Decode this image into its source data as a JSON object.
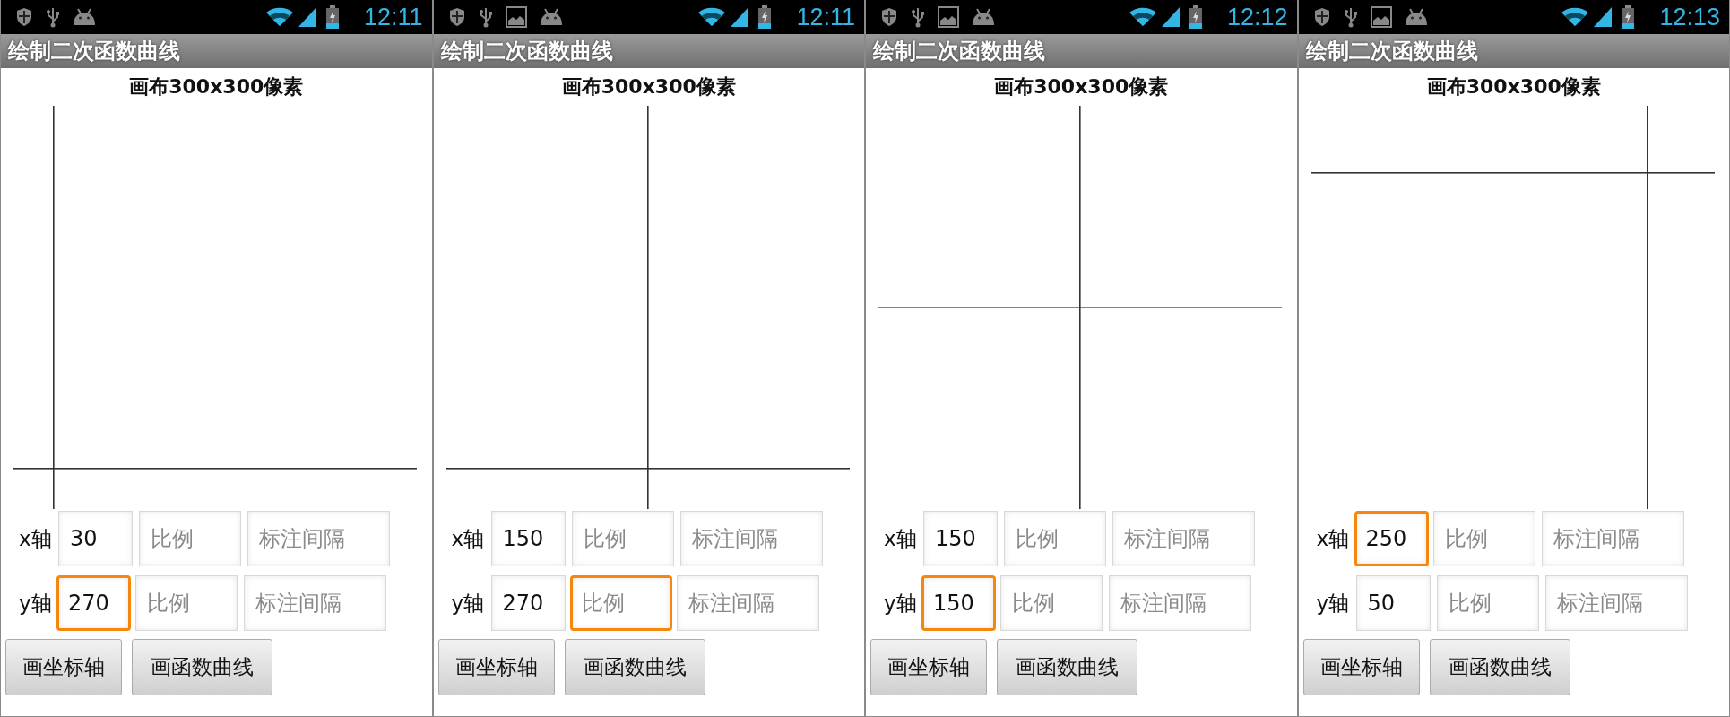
{
  "phones": [
    {
      "status_bar": {
        "notification_icons": [
          {
            "kind": "shield"
          },
          {
            "kind": "usb"
          },
          {
            "kind": "android"
          }
        ],
        "time": "12:11"
      },
      "title": "绘制二次函数曲线",
      "canvas_label": "画布300x300像素",
      "rows": [
        {
          "label": "x轴",
          "fields": [
            {
              "value": "30",
              "focused": false
            },
            {
              "placeholder": "比例",
              "focused": false
            },
            {
              "placeholder": "标注间隔",
              "focused": false
            }
          ]
        },
        {
          "label": "y轴",
          "fields": [
            {
              "value": "270",
              "focused": true
            },
            {
              "placeholder": "比例",
              "focused": false
            },
            {
              "placeholder": "标注间隔",
              "focused": false
            }
          ]
        }
      ],
      "buttons": [
        "画坐标轴",
        "画函数曲线"
      ]
    },
    {
      "status_bar": {
        "notification_icons": [
          {
            "kind": "shield"
          },
          {
            "kind": "usb"
          },
          {
            "kind": "picture"
          },
          {
            "kind": "android"
          }
        ],
        "time": "12:11"
      },
      "title": "绘制二次函数曲线",
      "canvas_label": "画布300x300像素",
      "rows": [
        {
          "label": "x轴",
          "fields": [
            {
              "value": "150",
              "focused": false
            },
            {
              "placeholder": "比例",
              "focused": false
            },
            {
              "placeholder": "标注间隔",
              "focused": false
            }
          ]
        },
        {
          "label": "y轴",
          "fields": [
            {
              "value": "270",
              "focused": false
            },
            {
              "placeholder": "比例",
              "focused": true
            },
            {
              "placeholder": "标注间隔",
              "focused": false
            }
          ]
        }
      ],
      "buttons": [
        "画坐标轴",
        "画函数曲线"
      ]
    },
    {
      "status_bar": {
        "notification_icons": [
          {
            "kind": "shield"
          },
          {
            "kind": "usb"
          },
          {
            "kind": "picture"
          },
          {
            "kind": "android"
          }
        ],
        "time": "12:12"
      },
      "title": "绘制二次函数曲线",
      "canvas_label": "画布300x300像素",
      "rows": [
        {
          "label": "x轴",
          "fields": [
            {
              "value": "150",
              "focused": false
            },
            {
              "placeholder": "比例",
              "focused": false
            },
            {
              "placeholder": "标注间隔",
              "focused": false
            }
          ]
        },
        {
          "label": "y轴",
          "fields": [
            {
              "value": "150",
              "focused": true
            },
            {
              "placeholder": "比例",
              "focused": false
            },
            {
              "placeholder": "标注间隔",
              "focused": false
            }
          ]
        }
      ],
      "buttons": [
        "画坐标轴",
        "画函数曲线"
      ]
    },
    {
      "status_bar": {
        "notification_icons": [
          {
            "kind": "shield"
          },
          {
            "kind": "usb"
          },
          {
            "kind": "picture"
          },
          {
            "kind": "android"
          }
        ],
        "time": "12:13"
      },
      "title": "绘制二次函数曲线",
      "canvas_label": "画布300x300像素",
      "rows": [
        {
          "label": "x轴",
          "fields": [
            {
              "value": "250",
              "focused": true
            },
            {
              "placeholder": "比例",
              "focused": false
            },
            {
              "placeholder": "标注间隔",
              "focused": false
            }
          ]
        },
        {
          "label": "y轴",
          "fields": [
            {
              "value": "50",
              "focused": false
            },
            {
              "placeholder": "比例",
              "focused": false
            },
            {
              "placeholder": "标注间隔",
              "focused": false
            }
          ]
        }
      ],
      "buttons": [
        "画坐标轴",
        "画函数曲线"
      ]
    }
  ]
}
